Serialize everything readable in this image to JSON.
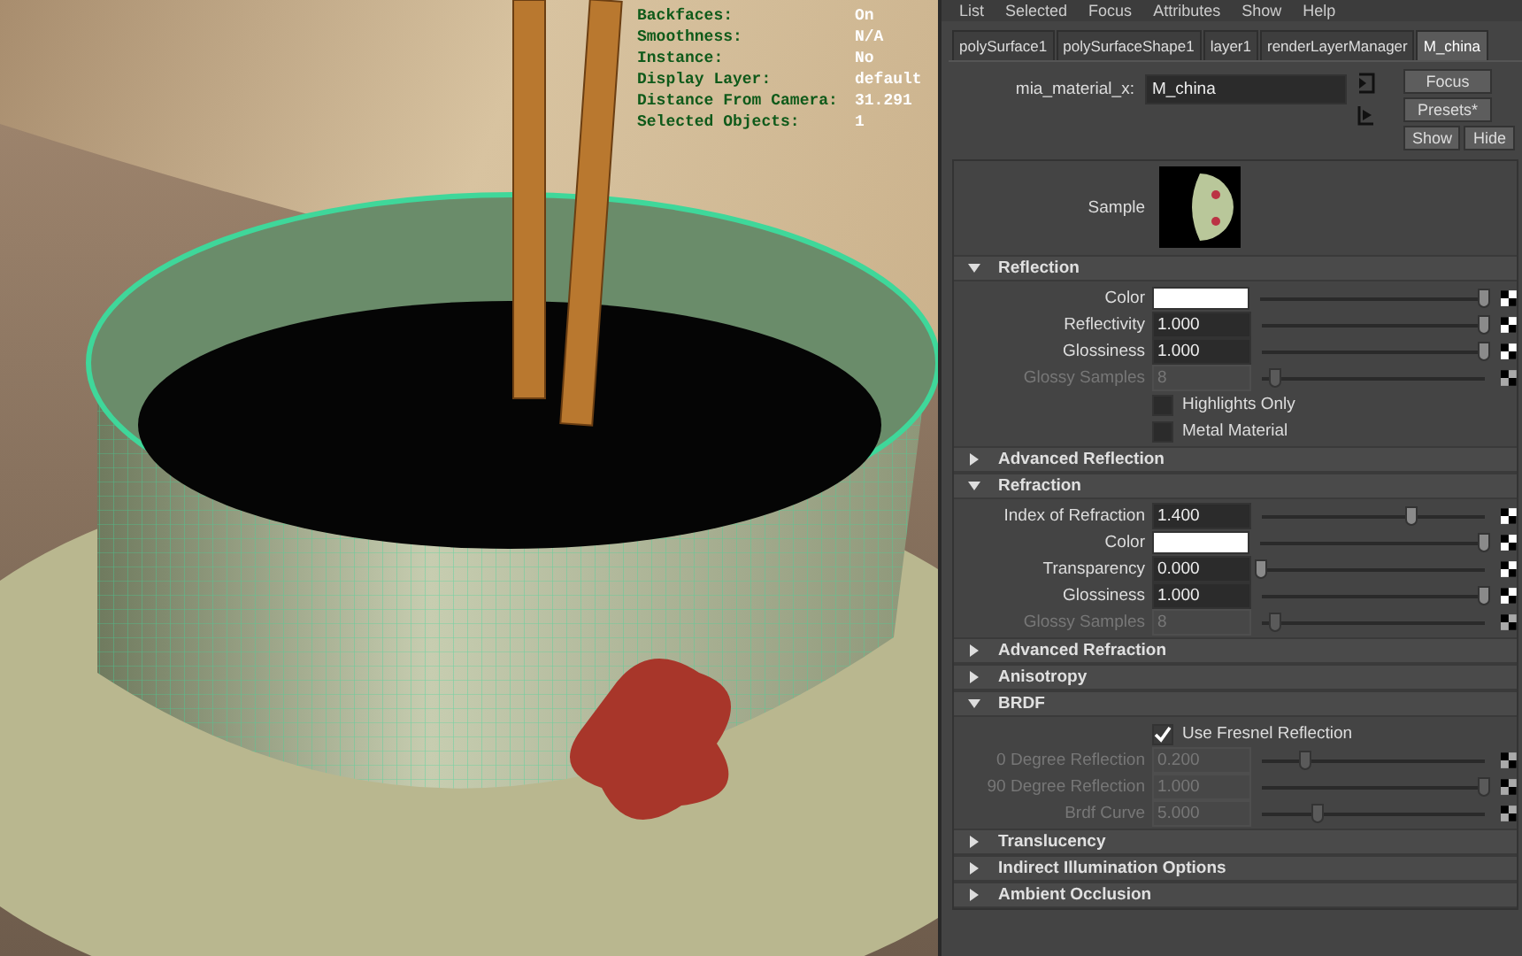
{
  "hud": [
    {
      "label": "Backfaces:",
      "value": "On"
    },
    {
      "label": "Smoothness:",
      "value": "N/A"
    },
    {
      "label": "Instance:",
      "value": "No"
    },
    {
      "label": "Display Layer:",
      "value": "default"
    },
    {
      "label": "Distance From Camera:",
      "value": "31.291"
    },
    {
      "label": "Selected Objects:",
      "value": "1"
    }
  ],
  "menu": [
    "List",
    "Selected",
    "Focus",
    "Attributes",
    "Show",
    "Help"
  ],
  "tabs": [
    {
      "label": "polySurface1",
      "selected": false
    },
    {
      "label": "polySurfaceShape1",
      "selected": false
    },
    {
      "label": "layer1",
      "selected": false
    },
    {
      "label": "renderLayerManager",
      "selected": false
    },
    {
      "label": "M_china",
      "selected": true
    }
  ],
  "node": {
    "label": "mia_material_x:",
    "value": "M_china"
  },
  "buttons": [
    "Focus",
    "Presets*",
    "Show",
    "Hide"
  ],
  "sample": {
    "label": "Sample"
  },
  "sections": [
    {
      "title": "Reflection",
      "expanded": true,
      "rows": [
        {
          "kind": "color",
          "label": "Color",
          "color": "#ffffff",
          "level": 1,
          "disabled": false
        },
        {
          "kind": "slider",
          "label": "Reflectivity",
          "value": "1.000",
          "level": 1,
          "disabled": false
        },
        {
          "kind": "slider",
          "label": "Glossiness",
          "value": "1.000",
          "level": 1,
          "disabled": false
        },
        {
          "kind": "slider",
          "label": "Glossy Samples",
          "value": "8",
          "level": 0.06,
          "disabled": true
        },
        {
          "kind": "checkbox",
          "label": "Highlights Only",
          "checked": false
        },
        {
          "kind": "checkbox",
          "label": "Metal Material",
          "checked": false
        }
      ]
    },
    {
      "title": "Advanced Reflection",
      "expanded": false
    },
    {
      "title": "Refraction",
      "expanded": true,
      "rows": [
        {
          "kind": "slider",
          "label": "Index of Refraction",
          "value": "1.400",
          "level": 0.67,
          "disabled": false
        },
        {
          "kind": "color",
          "label": "Color",
          "color": "#ffffff",
          "level": 1,
          "disabled": false
        },
        {
          "kind": "slider",
          "label": "Transparency",
          "value": "0.000",
          "level": 0,
          "disabled": false
        },
        {
          "kind": "slider",
          "label": "Glossiness",
          "value": "1.000",
          "level": 1,
          "disabled": false
        },
        {
          "kind": "slider",
          "label": "Glossy Samples",
          "value": "8",
          "level": 0.06,
          "disabled": true
        }
      ]
    },
    {
      "title": "Advanced Refraction",
      "expanded": false
    },
    {
      "title": "Anisotropy",
      "expanded": false
    },
    {
      "title": "BRDF",
      "expanded": true,
      "rows": [
        {
          "kind": "checkbox",
          "label": "Use Fresnel Reflection",
          "checked": true
        },
        {
          "kind": "slider",
          "label": "0 Degree Reflection",
          "value": "0.200",
          "level": 0.2,
          "disabled": true
        },
        {
          "kind": "slider",
          "label": "90 Degree Reflection",
          "value": "1.000",
          "level": 1,
          "disabled": true
        },
        {
          "kind": "slider",
          "label": "Brdf Curve",
          "value": "5.000",
          "level": 0.25,
          "disabled": true
        }
      ]
    },
    {
      "title": "Translucency",
      "expanded": false
    },
    {
      "title": "Indirect Illumination Options",
      "expanded": false
    },
    {
      "title": "Ambient Occlusion",
      "expanded": false
    }
  ]
}
